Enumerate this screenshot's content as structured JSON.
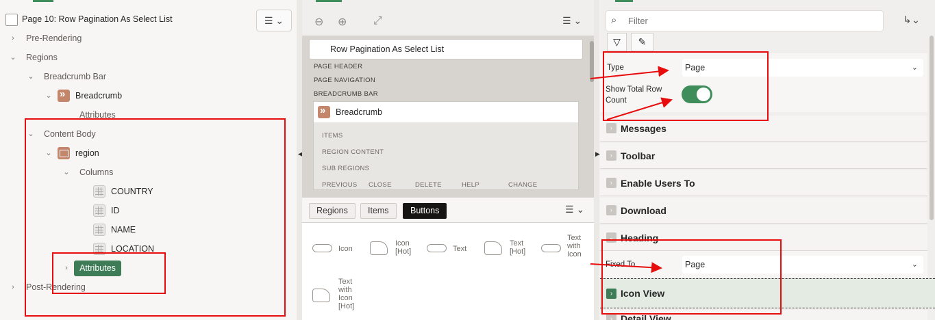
{
  "left": {
    "page_title": "Page 10: Row Pagination As Select List",
    "menu_icon": "menu-icon",
    "tree": {
      "pre_rendering": "Pre-Rendering",
      "regions": "Regions",
      "breadcrumb_bar": "Breadcrumb Bar",
      "breadcrumb": "Breadcrumb",
      "breadcrumb_attributes": "Attributes",
      "content_body": "Content Body",
      "region": "region",
      "columns": "Columns",
      "column_items": [
        "COUNTRY",
        "ID",
        "NAME",
        "LOCATION"
      ],
      "attributes_selected": "Attributes",
      "post_rendering": "Post-Rendering"
    }
  },
  "middle": {
    "page_title": "Row Pagination As Select List",
    "labels": [
      "PAGE HEADER",
      "PAGE NAVIGATION",
      "BREADCRUMB BAR"
    ],
    "breadcrumb": "Breadcrumb",
    "sub_labels": [
      "ITEMS",
      "REGION CONTENT",
      "SUB REGIONS"
    ],
    "bottom_labels": [
      "PREVIOUS",
      "CLOSE",
      "DELETE",
      "HELP",
      "CHANGE"
    ],
    "tabs": [
      "Regions",
      "Items",
      "Buttons"
    ],
    "gallery": [
      {
        "label": "Icon"
      },
      {
        "label": "Icon [Hot]"
      },
      {
        "label": "Text"
      },
      {
        "label": "Text [Hot]"
      },
      {
        "label": "Text with Icon"
      },
      {
        "label": "Text with Icon [Hot]"
      }
    ]
  },
  "right": {
    "filter_placeholder": "Filter",
    "type_label": "Type",
    "type_value": "Page",
    "show_total_label": "Show Total Row Count",
    "sections": [
      "Messages",
      "Toolbar",
      "Enable Users To",
      "Download",
      "Heading"
    ],
    "fixed_to_label": "Fixed To",
    "fixed_to_value": "Page",
    "icon_view": "Icon View",
    "detail_view": "Detail View"
  }
}
